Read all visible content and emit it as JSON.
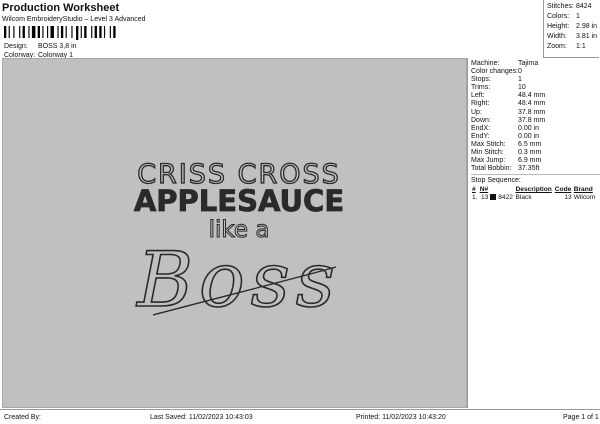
{
  "header": {
    "title": "Production Worksheet",
    "subtitle": "Wilcom EmbroideryStudio – Level 3 Advanced",
    "design_label": "Design:",
    "design_value": "BOSS 3,8 in",
    "colorway_label": "Colorway:",
    "colorway_value": "Colorway 1"
  },
  "summary": [
    {
      "label": "Stitches:",
      "value": "8424"
    },
    {
      "label": "Colors:",
      "value": "1"
    },
    {
      "label": "Height:",
      "value": "2.98 in"
    },
    {
      "label": "Width:",
      "value": "3.81 in"
    },
    {
      "label": "Zoom:",
      "value": "1:1"
    }
  ],
  "design": {
    "line1": "CRISS CROSS",
    "line2": "APPLESAUCE",
    "line3": "like a",
    "line4": "Boss",
    "thread_color": "#2a2a2a",
    "background_color": "#c0c0c0"
  },
  "machine_info": [
    {
      "label": "Machine:",
      "value": "Tajima"
    },
    {
      "label": "Color changes:",
      "value": "0"
    },
    {
      "label": "Stops:",
      "value": "1"
    },
    {
      "label": "Trims:",
      "value": "10"
    },
    {
      "label": "Left:",
      "value": "48.4 mm"
    },
    {
      "label": "Right:",
      "value": "48.4 mm"
    },
    {
      "label": "Up:",
      "value": "37.8 mm"
    },
    {
      "label": "Down:",
      "value": "37.8 mm"
    },
    {
      "label": "EndX:",
      "value": "0.00 in"
    },
    {
      "label": "EndY:",
      "value": "0.00 in"
    },
    {
      "label": "Max Stitch:",
      "value": "6.5 mm"
    },
    {
      "label": "Min Stitch:",
      "value": "0.3 mm"
    },
    {
      "label": "Max Jump:",
      "value": "6.9 mm"
    },
    {
      "label": "Total Bobbin:",
      "value": "37.35ft"
    }
  ],
  "stop_sequence": {
    "title": "Stop Sequence:",
    "headers": [
      "#",
      "N#",
      "",
      "Description",
      "Code",
      "Brand"
    ],
    "rows": [
      {
        "index": "1.",
        "needle": "13",
        "stitches": "8422",
        "description": "Black",
        "code": "13",
        "brand": "Wilcom",
        "color": "#111111"
      }
    ]
  },
  "footer": {
    "created_by": "Created By:",
    "last_saved": "Last Saved: 11/02/2023 10:43:03",
    "printed": "Printed: 11/02/2023 10:43:20",
    "page": "Page 1 of 1"
  }
}
